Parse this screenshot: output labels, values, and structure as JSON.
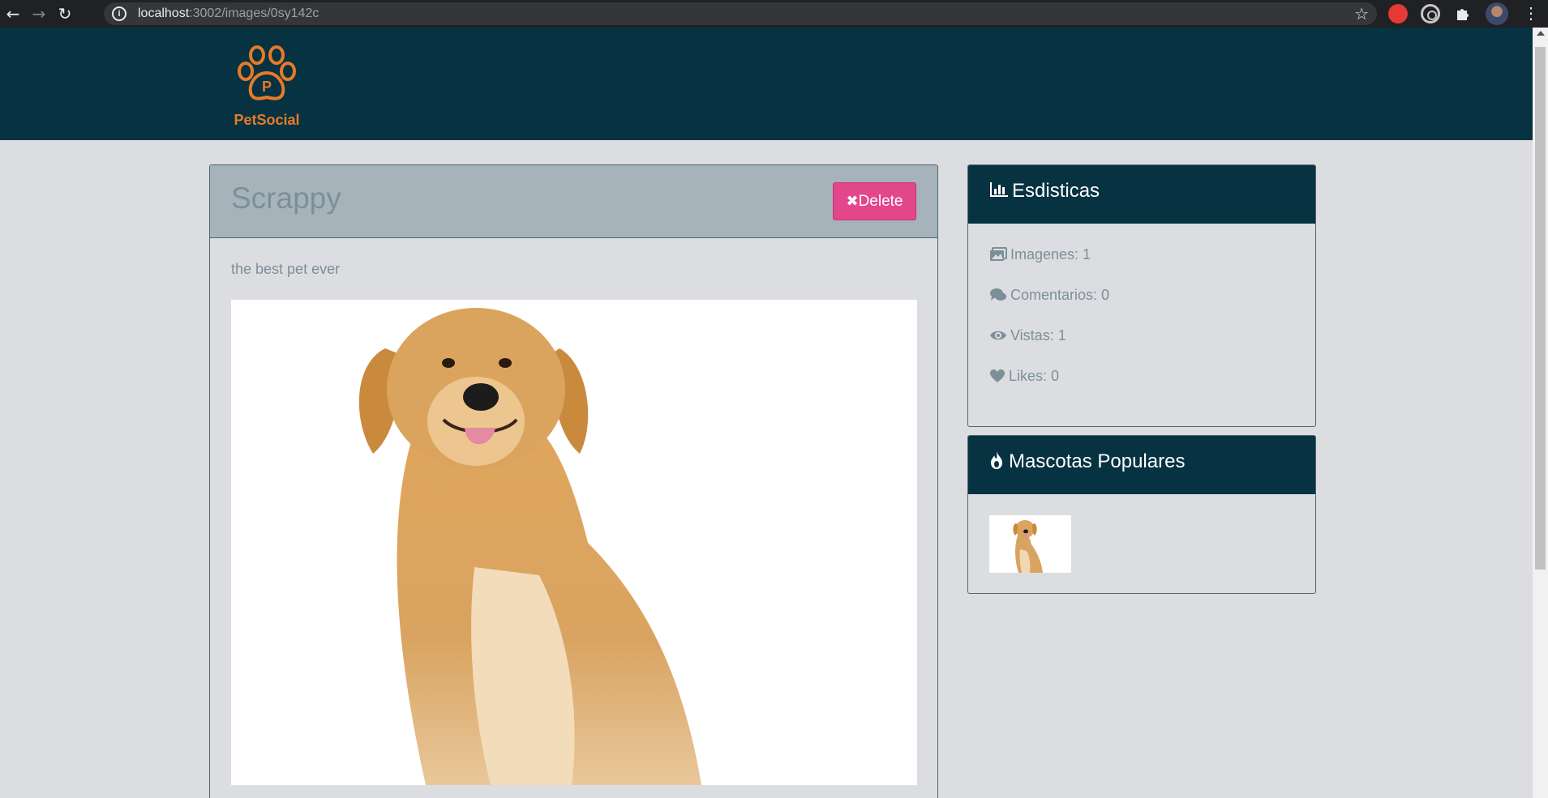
{
  "browser": {
    "url_host": "localhost",
    "url_rest": ":3002/images/0sy142c"
  },
  "site": {
    "brand": "PetSocial",
    "logo_letter": "P"
  },
  "image": {
    "title": "Scrappy",
    "delete_label": "Delete",
    "description": "the best pet ever"
  },
  "stats": {
    "heading": "Esdisticas",
    "items": [
      {
        "icon": "images-icon",
        "label": "Imagenes: 1"
      },
      {
        "icon": "comments-icon",
        "label": "Comentarios: 0"
      },
      {
        "icon": "eye-icon",
        "label": "Vistas: 1"
      },
      {
        "icon": "heart-icon",
        "label": "Likes: 0"
      }
    ]
  },
  "popular": {
    "heading": "Mascotas Populares"
  },
  "colors": {
    "header_bg": "#073241",
    "brand_orange": "#e57b29",
    "delete_pink": "#e2478c",
    "page_bg": "#dcdde1"
  }
}
